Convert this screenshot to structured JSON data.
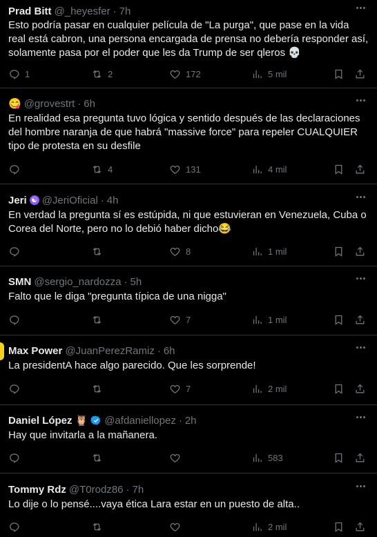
{
  "tweets": [
    {
      "name": "Prad Bitt",
      "handle": "@_heyesfer",
      "time": "7h",
      "text": "Esto podría pasar en cualquier película de \"La purga\", que pase en la vida real está cabron, una persona encargada de prensa no debería responder así, solamente pasa por el poder que les da Trump de ser qleros 💀",
      "replies": "1",
      "retweets": "2",
      "likes": "172",
      "views": "5 mil"
    },
    {
      "name": "",
      "handle": "@grovestrt",
      "time": "6h",
      "text": "En realidad esa pregunta tuvo lógica y sentido después de las declaraciones del hombre naranja de que habrá \"massive force\" para repeler CUALQUIER tipo de protesta en su desfile",
      "replies": "",
      "retweets": "4",
      "likes": "131",
      "views": "4 mil"
    },
    {
      "name": "Jeri",
      "handle": "@JeriOficial",
      "time": "4h",
      "text": "En verdad la pregunta sí es estúpida, ni que estuvieran en Venezuela, Cuba o Corea del Norte, pero no lo debió haber dicho😂",
      "replies": "",
      "retweets": "",
      "likes": "8",
      "views": "1 mil"
    },
    {
      "name": "SMN",
      "handle": "@sergio_nardozza",
      "time": "5h",
      "text": "Falto que le diga \"pregunta típica de una nigga\"",
      "replies": "",
      "retweets": "",
      "likes": "7",
      "views": "1 mil"
    },
    {
      "name": "Max Power",
      "handle": "@JuanPerezRamiz",
      "time": "6h",
      "text": "La presidentA hace algo parecido. Que les sorprende!",
      "replies": "",
      "retweets": "",
      "likes": "7",
      "views": "2 mil"
    },
    {
      "name": "Daniel López",
      "handle": "@afdaniellopez",
      "time": "2h",
      "text": "Hay que invitarla a la mañanera.",
      "replies": "",
      "retweets": "",
      "likes": "",
      "views": "583"
    },
    {
      "name": "Tommy Rdz",
      "handle": "@T0rodz86",
      "time": "7h",
      "text": "Lo dije o lo pensé....vaya ética Lara estar en un puesto de alta..",
      "replies": "",
      "retweets": "",
      "likes": "",
      "views": "2 mil"
    }
  ],
  "emoji": {
    "t2": "😋",
    "t3": "☯",
    "t6": "🦉"
  },
  "icons": [
    "reply-icon",
    "retweet-icon",
    "like-icon",
    "views-icon",
    "bookmark-icon",
    "share-icon",
    "more-icon",
    "verified-icon"
  ],
  "colors": {
    "background": "#000000",
    "text": "#e7e9ea",
    "muted": "#71767b",
    "divider": "#2f3336",
    "verified": "#1d9bf0"
  }
}
